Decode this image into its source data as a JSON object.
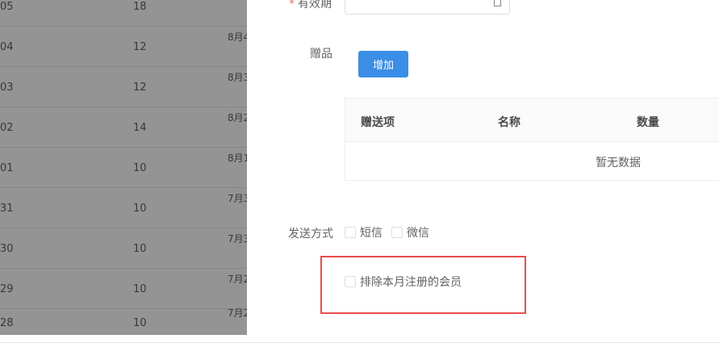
{
  "background_table": {
    "rows": [
      {
        "c1": "05",
        "c2": "18",
        "c3": ""
      },
      {
        "c1": "04",
        "c2": "12",
        "c3": "8月4"
      },
      {
        "c1": "03",
        "c2": "12",
        "c3": "8月3"
      },
      {
        "c1": "02",
        "c2": "14",
        "c3": "8月2"
      },
      {
        "c1": "01",
        "c2": "10",
        "c3": "8月1"
      },
      {
        "c1": "31",
        "c2": "10",
        "c3": "7月3"
      },
      {
        "c1": "30",
        "c2": "10",
        "c3": "7月3"
      },
      {
        "c1": "29",
        "c2": "10",
        "c3": "7月2"
      },
      {
        "c1": "28",
        "c2": "10",
        "c3": "7月2"
      }
    ]
  },
  "form": {
    "validity_label": "有效期",
    "required_mark": "*",
    "gift_label": "赠品",
    "add_button": "增加",
    "gift_table": {
      "headers": [
        "赠送项",
        "名称",
        "数量"
      ],
      "empty_text": "暂无数据"
    },
    "send_method_label": "发送方式",
    "send_options": [
      "短信",
      "微信"
    ],
    "exclude_label": "排除本月注册的会员"
  },
  "colors": {
    "primary": "#3a8ee6",
    "highlight_border": "#e84c4c",
    "required": "#f56c6c"
  }
}
